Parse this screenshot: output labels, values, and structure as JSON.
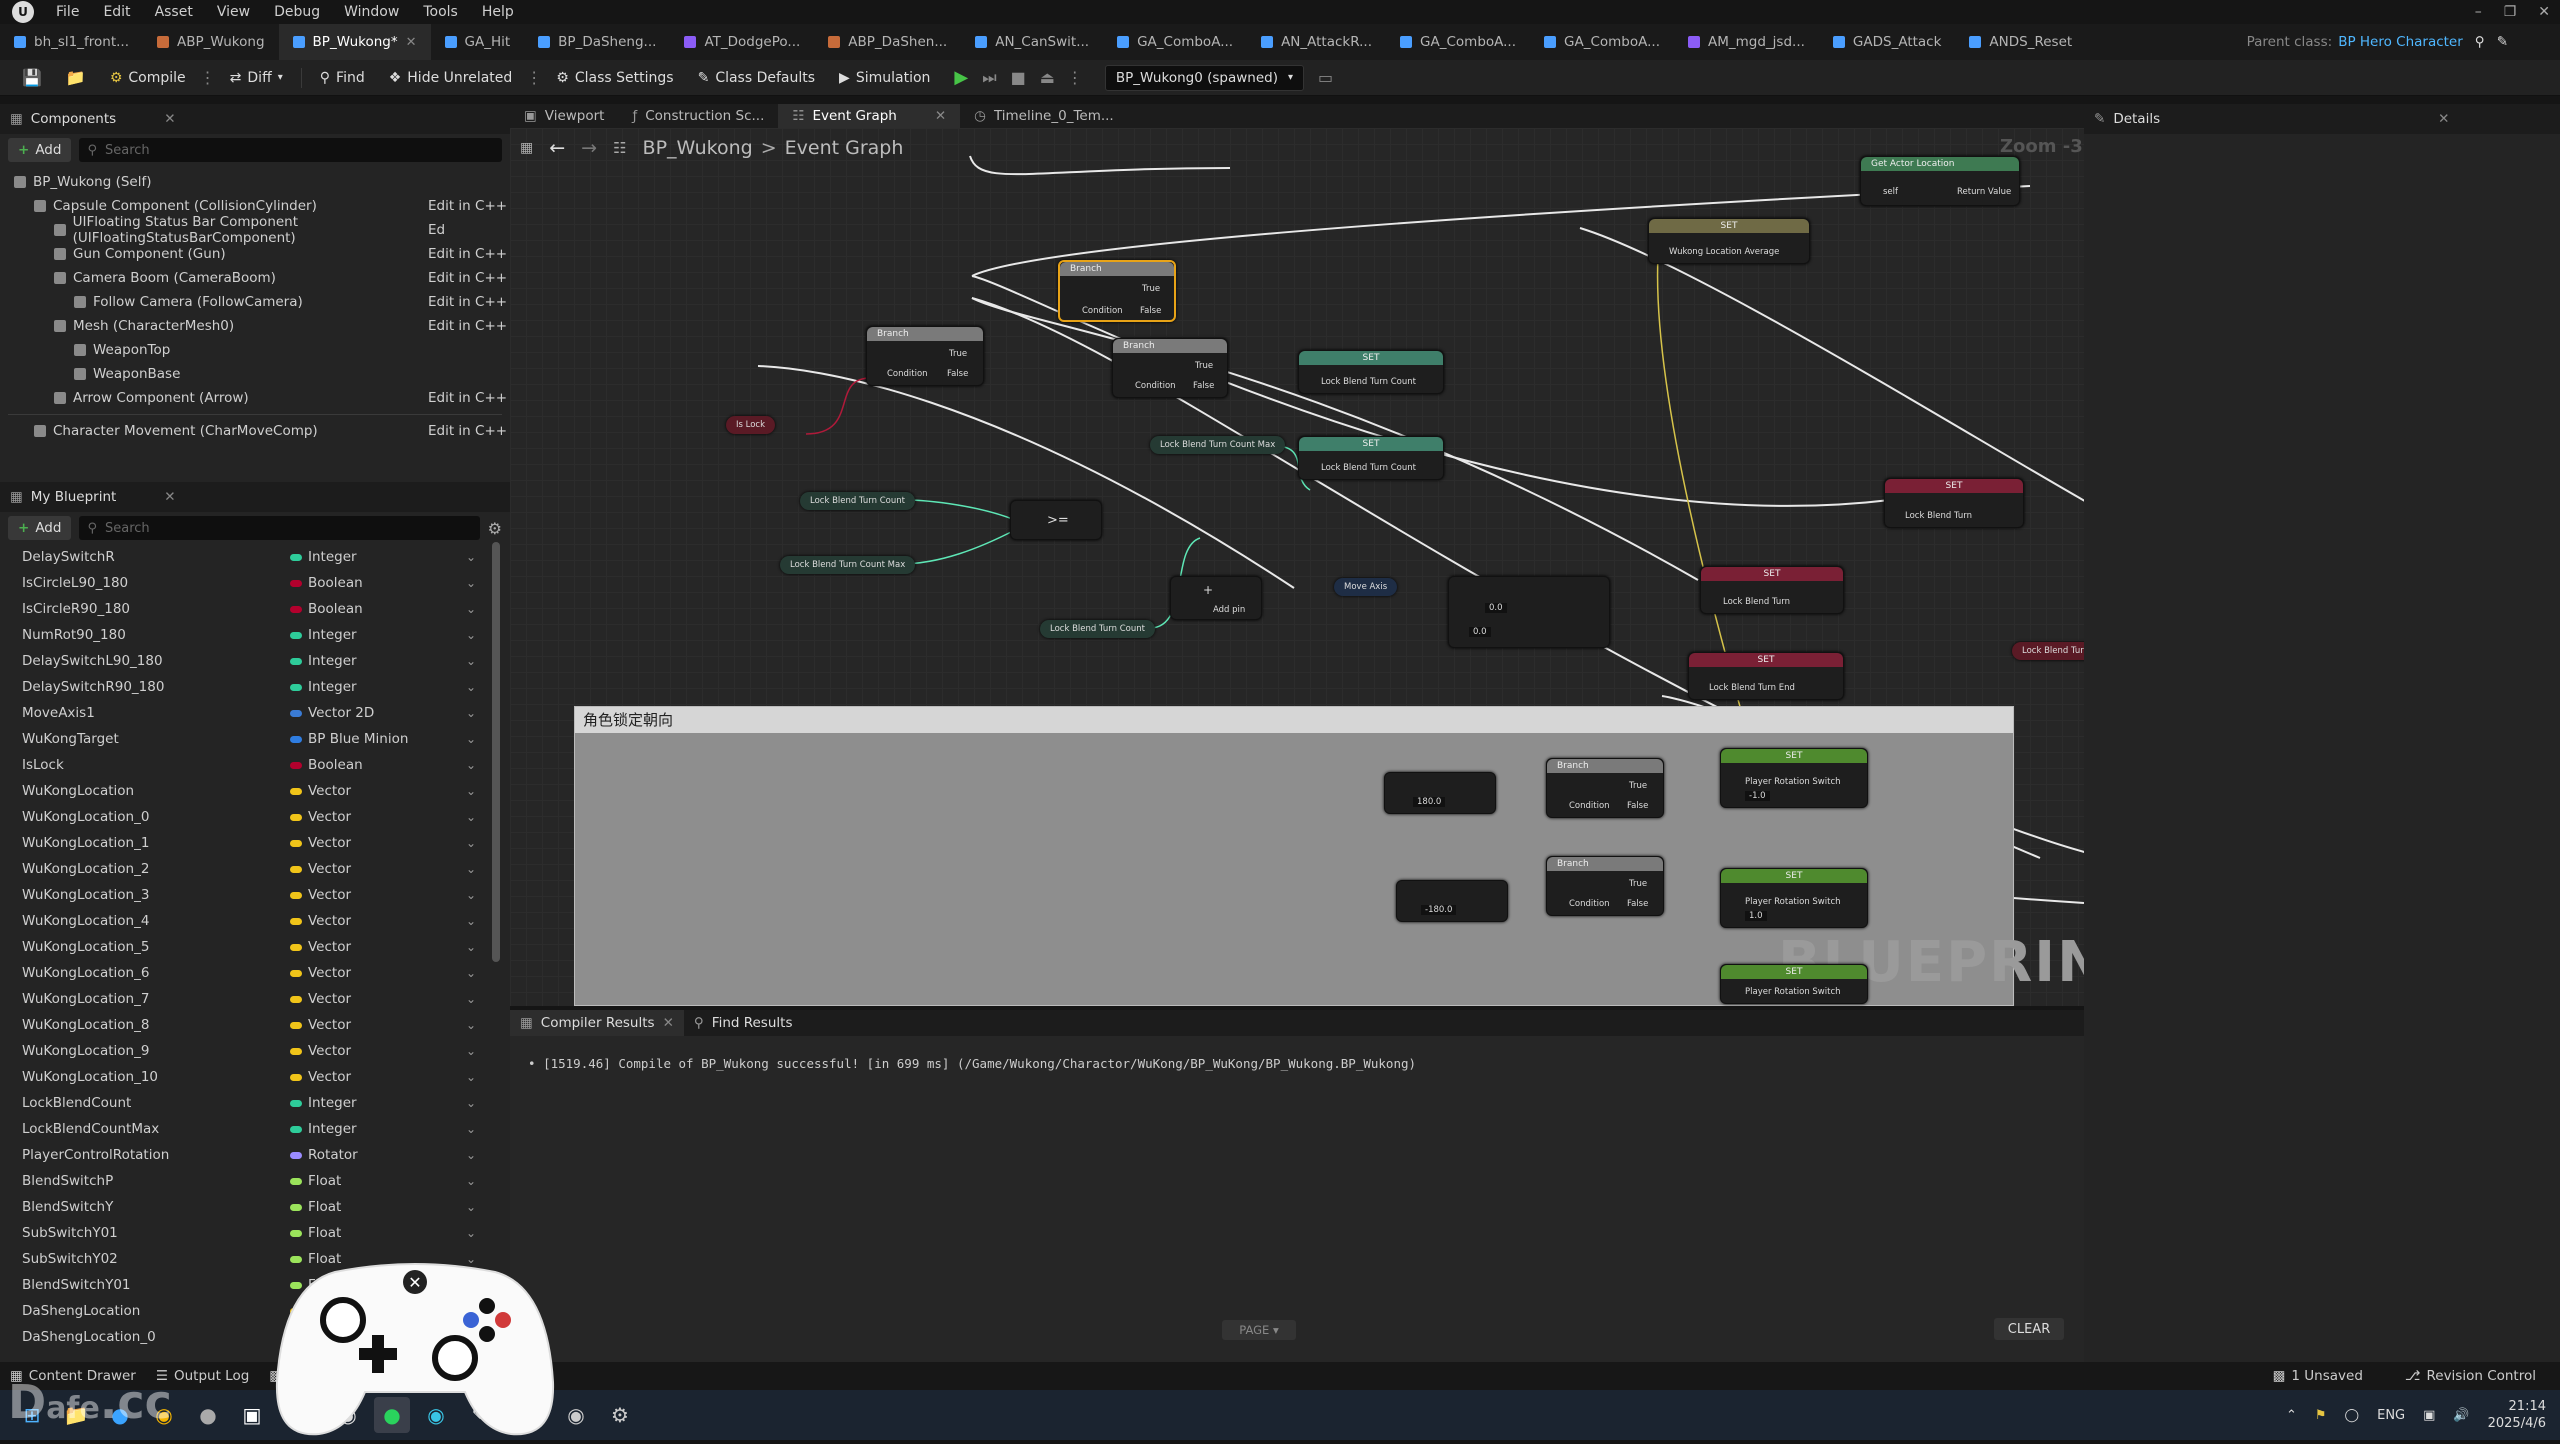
{
  "menu": [
    "File",
    "Edit",
    "Asset",
    "View",
    "Debug",
    "Window",
    "Tools",
    "Help"
  ],
  "tabs": [
    {
      "label": "bh_sl1_front...",
      "color": "#4a9eff",
      "active": false
    },
    {
      "label": "ABP_Wukong",
      "color": "#c76b3a",
      "active": false
    },
    {
      "label": "BP_Wukong*",
      "color": "#4a9eff",
      "active": true
    },
    {
      "label": "GA_Hit",
      "color": "#4a9eff",
      "active": false
    },
    {
      "label": "BP_DaSheng...",
      "color": "#4a9eff",
      "active": false
    },
    {
      "label": "AT_DodgePo...",
      "color": "#8b5cf6",
      "active": false
    },
    {
      "label": "ABP_DaShen...",
      "color": "#c76b3a",
      "active": false
    },
    {
      "label": "AN_CanSwit...",
      "color": "#4a9eff",
      "active": false
    },
    {
      "label": "GA_ComboA...",
      "color": "#4a9eff",
      "active": false
    },
    {
      "label": "AN_AttackR...",
      "color": "#4a9eff",
      "active": false
    },
    {
      "label": "GA_ComboA...",
      "color": "#4a9eff",
      "active": false
    },
    {
      "label": "GA_ComboA...",
      "color": "#4a9eff",
      "active": false
    },
    {
      "label": "AM_mgd_jsd...",
      "color": "#8b5cf6",
      "active": false
    },
    {
      "label": "GADS_Attack",
      "color": "#4a9eff",
      "active": false
    },
    {
      "label": "ANDS_Reset",
      "color": "#4a9eff",
      "active": false
    }
  ],
  "parent_class": {
    "label": "Parent class:",
    "value": "BP Hero Character"
  },
  "toolbar": {
    "compile": "Compile",
    "diff": "Diff",
    "find": "Find",
    "hide_unrelated": "Hide Unrelated",
    "class_settings": "Class Settings",
    "class_defaults": "Class Defaults",
    "simulation": "Simulation",
    "debug_object": "BP_Wukong0 (spawned)"
  },
  "components": {
    "title": "Components",
    "add": "Add",
    "search_placeholder": "Search",
    "items": [
      {
        "label": "BP_Wukong (Self)",
        "indent": 0,
        "edit": ""
      },
      {
        "label": "Capsule Component (CollisionCylinder)",
        "indent": 1,
        "edit": "Edit in C++"
      },
      {
        "label": "UIFloating Status Bar Component (UIFloatingStatusBarComponent)",
        "indent": 2,
        "edit": "Ed"
      },
      {
        "label": "Gun Component (Gun)",
        "indent": 2,
        "edit": "Edit in C++"
      },
      {
        "label": "Camera Boom (CameraBoom)",
        "indent": 2,
        "edit": "Edit in C++"
      },
      {
        "label": "Follow Camera (FollowCamera)",
        "indent": 3,
        "edit": "Edit in C++"
      },
      {
        "label": "Mesh (CharacterMesh0)",
        "indent": 2,
        "edit": "Edit in C++"
      },
      {
        "label": "WeaponTop",
        "indent": 3,
        "edit": ""
      },
      {
        "label": "WeaponBase",
        "indent": 3,
        "edit": ""
      },
      {
        "label": "Arrow Component (Arrow)",
        "indent": 2,
        "edit": "Edit in C++"
      },
      {
        "label": "Character Movement (CharMoveComp)",
        "indent": 1,
        "edit": "Edit in C++"
      }
    ]
  },
  "my_blueprint": {
    "title": "My Blueprint",
    "add": "Add",
    "search_placeholder": "Search",
    "variables": [
      {
        "name": "DelaySwitchR",
        "type": "Integer",
        "color": "#2ecc9a"
      },
      {
        "name": "IsCircleL90_180",
        "type": "Boolean",
        "color": "#b3002d"
      },
      {
        "name": "IsCircleR90_180",
        "type": "Boolean",
        "color": "#b3002d"
      },
      {
        "name": "NumRot90_180",
        "type": "Integer",
        "color": "#2ecc9a"
      },
      {
        "name": "DelaySwitchL90_180",
        "type": "Integer",
        "color": "#2ecc9a"
      },
      {
        "name": "DelaySwitchR90_180",
        "type": "Integer",
        "color": "#2ecc9a"
      },
      {
        "name": "MoveAxis1",
        "type": "Vector 2D",
        "color": "#3a7bd5"
      },
      {
        "name": "WuKongTarget",
        "type": "BP Blue Minion",
        "color": "#2f7de1"
      },
      {
        "name": "IsLock",
        "type": "Boolean",
        "color": "#b3002d"
      },
      {
        "name": "WuKongLocation",
        "type": "Vector",
        "color": "#f0c419"
      },
      {
        "name": "WuKongLocation_0",
        "type": "Vector",
        "color": "#f0c419"
      },
      {
        "name": "WuKongLocation_1",
        "type": "Vector",
        "color": "#f0c419"
      },
      {
        "name": "WuKongLocation_2",
        "type": "Vector",
        "color": "#f0c419"
      },
      {
        "name": "WuKongLocation_3",
        "type": "Vector",
        "color": "#f0c419"
      },
      {
        "name": "WuKongLocation_4",
        "type": "Vector",
        "color": "#f0c419"
      },
      {
        "name": "WuKongLocation_5",
        "type": "Vector",
        "color": "#f0c419"
      },
      {
        "name": "WuKongLocation_6",
        "type": "Vector",
        "color": "#f0c419"
      },
      {
        "name": "WuKongLocation_7",
        "type": "Vector",
        "color": "#f0c419"
      },
      {
        "name": "WuKongLocation_8",
        "type": "Vector",
        "color": "#f0c419"
      },
      {
        "name": "WuKongLocation_9",
        "type": "Vector",
        "color": "#f0c419"
      },
      {
        "name": "WuKongLocation_10",
        "type": "Vector",
        "color": "#f0c419"
      },
      {
        "name": "LockBlendCount",
        "type": "Integer",
        "color": "#2ecc9a"
      },
      {
        "name": "LockBlendCountMax",
        "type": "Integer",
        "color": "#2ecc9a"
      },
      {
        "name": "PlayerControlRotation",
        "type": "Rotator",
        "color": "#9b8cff"
      },
      {
        "name": "BlendSwitchP",
        "type": "Float",
        "color": "#9be35b"
      },
      {
        "name": "BlendSwitchY",
        "type": "Float",
        "color": "#9be35b"
      },
      {
        "name": "SubSwitchY01",
        "type": "Float",
        "color": "#9be35b"
      },
      {
        "name": "SubSwitchY02",
        "type": "Float",
        "color": "#9be35b"
      },
      {
        "name": "BlendSwitchY01",
        "type": "Float",
        "color": "#9be35b"
      },
      {
        "name": "DaShengLocation",
        "type": "",
        "color": "#f0c419"
      },
      {
        "name": "DaShengLocation_0",
        "type": "",
        "color": "#f0c419"
      }
    ]
  },
  "graph_tabs": [
    {
      "label": "Viewport",
      "active": false
    },
    {
      "label": "Construction Sc...",
      "active": false
    },
    {
      "label": "Event Graph",
      "active": true
    },
    {
      "label": "Timeline_0_Tem...",
      "active": false
    }
  ],
  "breadcrumb": {
    "root": "BP_Wukong",
    "sep": ">",
    "leaf": "Event Graph"
  },
  "zoom": "Zoom -3",
  "nodes": {
    "branch": "Branch",
    "true": "True",
    "false": "False",
    "condition": "Condition",
    "set": "SET",
    "is_lock": "Is Lock",
    "lock_blend_turn_count": "Lock Blend Turn Count",
    "lock_blend_turn_count_max": "Lock Blend Turn Count Max",
    "lock_blend_turn": "Lock Blend Turn",
    "lock_blend_turn_end": "Lock Blend Turn End",
    "move_axis": "Move Axis",
    "add_pin": "Add pin",
    "wukong_location_average": "Wukong Location Average",
    "player_rotation_switch": "Player Rotation Switch",
    "get_actor_location": "Get Actor Location",
    "target_self": "self",
    "return_value": "Return Value",
    "compare": ">=",
    "val_180": "180.0",
    "val_neg180": "-180.0",
    "val_0": "0.0",
    "val_1": "1.0",
    "val_neg1": "-1.0"
  },
  "comment_title": "角色锁定朝向",
  "watermark": "BLUEPRINT",
  "compiler": {
    "tab1": "Compiler Results",
    "tab2": "Find Results",
    "message": "[1519.46] Compile of BP_Wukong successful! [in 699 ms] (/Game/Wukong/Charactor/WuKong/BP_WuKong/BP_Wukong.BP_Wukong)",
    "page": "PAGE",
    "clear": "CLEAR"
  },
  "details": {
    "title": "Details"
  },
  "statusbar": {
    "content_drawer": "Content Drawer",
    "output_log": "Output Log",
    "unsaved": "1 Unsaved",
    "revision_control": "Revision Control"
  },
  "taskbar": {
    "lang": "ENG",
    "time": "21:14",
    "date": "2025/4/6"
  }
}
